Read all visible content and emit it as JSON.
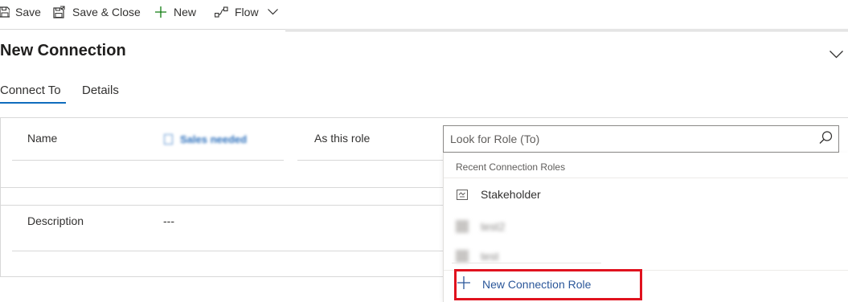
{
  "toolbar": {
    "save": "Save",
    "save_close": "Save & Close",
    "new": "New",
    "flow": "Flow"
  },
  "form": {
    "title": "New Connection",
    "tabs": [
      {
        "label": "Connect To",
        "active": true
      },
      {
        "label": "Details",
        "active": false
      }
    ],
    "fields": {
      "name_label": "Name",
      "name_value": "Sales needed",
      "role_label": "As this role",
      "description_label": "Description",
      "description_value": "---"
    }
  },
  "lookup": {
    "placeholder": "Look for Role (To)",
    "section_header": "Recent Connection Roles",
    "items": [
      {
        "label": "Stakeholder",
        "icon": "connection-role-icon",
        "blurred": false
      },
      {
        "label": "test2",
        "icon": "connection-role-icon",
        "blurred": true
      },
      {
        "label": "test",
        "icon": "connection-role-icon",
        "blurred": true
      }
    ],
    "new_role_label": "New Connection Role"
  },
  "colors": {
    "accent": "#0f6cbd",
    "link": "#2b579a",
    "highlight": "#e0121e"
  }
}
